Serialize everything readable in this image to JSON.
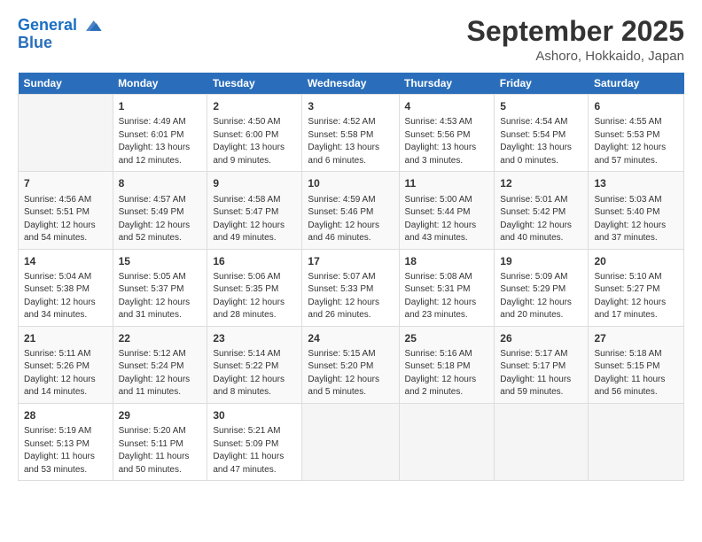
{
  "logo": {
    "line1": "General",
    "line2": "Blue"
  },
  "title": "September 2025",
  "location": "Ashoro, Hokkaido, Japan",
  "days_of_week": [
    "Sunday",
    "Monday",
    "Tuesday",
    "Wednesday",
    "Thursday",
    "Friday",
    "Saturday"
  ],
  "weeks": [
    [
      {
        "day": "",
        "info": ""
      },
      {
        "day": "1",
        "info": "Sunrise: 4:49 AM\nSunset: 6:01 PM\nDaylight: 13 hours\nand 12 minutes."
      },
      {
        "day": "2",
        "info": "Sunrise: 4:50 AM\nSunset: 6:00 PM\nDaylight: 13 hours\nand 9 minutes."
      },
      {
        "day": "3",
        "info": "Sunrise: 4:52 AM\nSunset: 5:58 PM\nDaylight: 13 hours\nand 6 minutes."
      },
      {
        "day": "4",
        "info": "Sunrise: 4:53 AM\nSunset: 5:56 PM\nDaylight: 13 hours\nand 3 minutes."
      },
      {
        "day": "5",
        "info": "Sunrise: 4:54 AM\nSunset: 5:54 PM\nDaylight: 13 hours\nand 0 minutes."
      },
      {
        "day": "6",
        "info": "Sunrise: 4:55 AM\nSunset: 5:53 PM\nDaylight: 12 hours\nand 57 minutes."
      }
    ],
    [
      {
        "day": "7",
        "info": "Sunrise: 4:56 AM\nSunset: 5:51 PM\nDaylight: 12 hours\nand 54 minutes."
      },
      {
        "day": "8",
        "info": "Sunrise: 4:57 AM\nSunset: 5:49 PM\nDaylight: 12 hours\nand 52 minutes."
      },
      {
        "day": "9",
        "info": "Sunrise: 4:58 AM\nSunset: 5:47 PM\nDaylight: 12 hours\nand 49 minutes."
      },
      {
        "day": "10",
        "info": "Sunrise: 4:59 AM\nSunset: 5:46 PM\nDaylight: 12 hours\nand 46 minutes."
      },
      {
        "day": "11",
        "info": "Sunrise: 5:00 AM\nSunset: 5:44 PM\nDaylight: 12 hours\nand 43 minutes."
      },
      {
        "day": "12",
        "info": "Sunrise: 5:01 AM\nSunset: 5:42 PM\nDaylight: 12 hours\nand 40 minutes."
      },
      {
        "day": "13",
        "info": "Sunrise: 5:03 AM\nSunset: 5:40 PM\nDaylight: 12 hours\nand 37 minutes."
      }
    ],
    [
      {
        "day": "14",
        "info": "Sunrise: 5:04 AM\nSunset: 5:38 PM\nDaylight: 12 hours\nand 34 minutes."
      },
      {
        "day": "15",
        "info": "Sunrise: 5:05 AM\nSunset: 5:37 PM\nDaylight: 12 hours\nand 31 minutes."
      },
      {
        "day": "16",
        "info": "Sunrise: 5:06 AM\nSunset: 5:35 PM\nDaylight: 12 hours\nand 28 minutes."
      },
      {
        "day": "17",
        "info": "Sunrise: 5:07 AM\nSunset: 5:33 PM\nDaylight: 12 hours\nand 26 minutes."
      },
      {
        "day": "18",
        "info": "Sunrise: 5:08 AM\nSunset: 5:31 PM\nDaylight: 12 hours\nand 23 minutes."
      },
      {
        "day": "19",
        "info": "Sunrise: 5:09 AM\nSunset: 5:29 PM\nDaylight: 12 hours\nand 20 minutes."
      },
      {
        "day": "20",
        "info": "Sunrise: 5:10 AM\nSunset: 5:27 PM\nDaylight: 12 hours\nand 17 minutes."
      }
    ],
    [
      {
        "day": "21",
        "info": "Sunrise: 5:11 AM\nSunset: 5:26 PM\nDaylight: 12 hours\nand 14 minutes."
      },
      {
        "day": "22",
        "info": "Sunrise: 5:12 AM\nSunset: 5:24 PM\nDaylight: 12 hours\nand 11 minutes."
      },
      {
        "day": "23",
        "info": "Sunrise: 5:14 AM\nSunset: 5:22 PM\nDaylight: 12 hours\nand 8 minutes."
      },
      {
        "day": "24",
        "info": "Sunrise: 5:15 AM\nSunset: 5:20 PM\nDaylight: 12 hours\nand 5 minutes."
      },
      {
        "day": "25",
        "info": "Sunrise: 5:16 AM\nSunset: 5:18 PM\nDaylight: 12 hours\nand 2 minutes."
      },
      {
        "day": "26",
        "info": "Sunrise: 5:17 AM\nSunset: 5:17 PM\nDaylight: 11 hours\nand 59 minutes."
      },
      {
        "day": "27",
        "info": "Sunrise: 5:18 AM\nSunset: 5:15 PM\nDaylight: 11 hours\nand 56 minutes."
      }
    ],
    [
      {
        "day": "28",
        "info": "Sunrise: 5:19 AM\nSunset: 5:13 PM\nDaylight: 11 hours\nand 53 minutes."
      },
      {
        "day": "29",
        "info": "Sunrise: 5:20 AM\nSunset: 5:11 PM\nDaylight: 11 hours\nand 50 minutes."
      },
      {
        "day": "30",
        "info": "Sunrise: 5:21 AM\nSunset: 5:09 PM\nDaylight: 11 hours\nand 47 minutes."
      },
      {
        "day": "",
        "info": ""
      },
      {
        "day": "",
        "info": ""
      },
      {
        "day": "",
        "info": ""
      },
      {
        "day": "",
        "info": ""
      }
    ]
  ]
}
